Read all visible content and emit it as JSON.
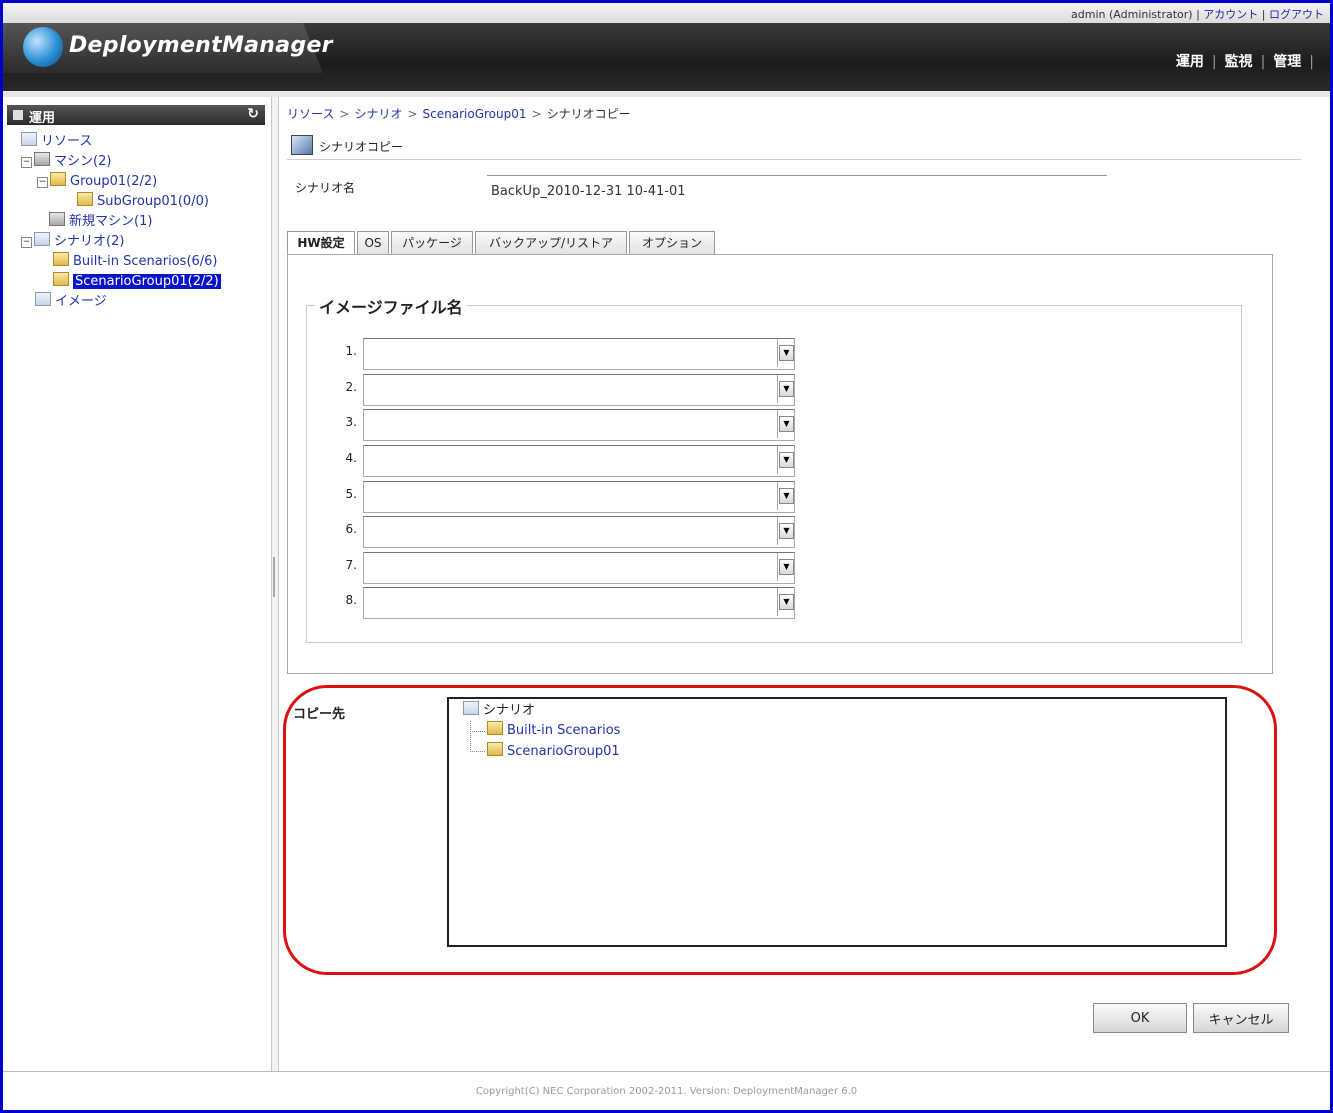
{
  "header": {
    "user": "admin (Administrator)",
    "account_link": "アカウント",
    "logout_link": "ログアウト",
    "product_name": "DeploymentManager",
    "nav": [
      "運用",
      "監視",
      "管理"
    ]
  },
  "sidebar": {
    "title": "運用",
    "tree": [
      {
        "label": "リソース"
      },
      {
        "label": "マシン(2)"
      },
      {
        "label": "Group01(2/2)"
      },
      {
        "label": "SubGroup01(0/0)"
      },
      {
        "label": "新規マシン(1)"
      },
      {
        "label": "シナリオ(2)"
      },
      {
        "label": "Built-in Scenarios(6/6)"
      },
      {
        "label": "ScenarioGroup01(2/2)"
      },
      {
        "label": "イメージ"
      }
    ]
  },
  "breadcrumb": [
    "リソース",
    "シナリオ",
    "ScenarioGroup01",
    "シナリオコピー"
  ],
  "page_title": "シナリオコピー",
  "scenario_name": {
    "label": "シナリオ名",
    "value": "BackUp_2010-12-31 10-41-01"
  },
  "tabs": [
    "HW設定",
    "OS",
    "パッケージ",
    "バックアップ/リストア",
    "オプション"
  ],
  "image_file": {
    "legend": "イメージファイル名",
    "rows": [
      "1.",
      "2.",
      "3.",
      "4.",
      "5.",
      "6.",
      "7.",
      "8."
    ]
  },
  "copy_dest": {
    "label": "コピー先",
    "root": "シナリオ",
    "children": [
      "Built-in Scenarios",
      "ScenarioGroup01"
    ]
  },
  "buttons": {
    "ok": "OK",
    "cancel": "キャンセル"
  },
  "footer": "Copyright(C) NEC Corporation 2002-2011. Version: DeploymentManager 6.0",
  "colors": {
    "frame": "#0000cc",
    "selection": "#0a14c8",
    "highlight": "#e01010",
    "link": "#2233aa"
  }
}
